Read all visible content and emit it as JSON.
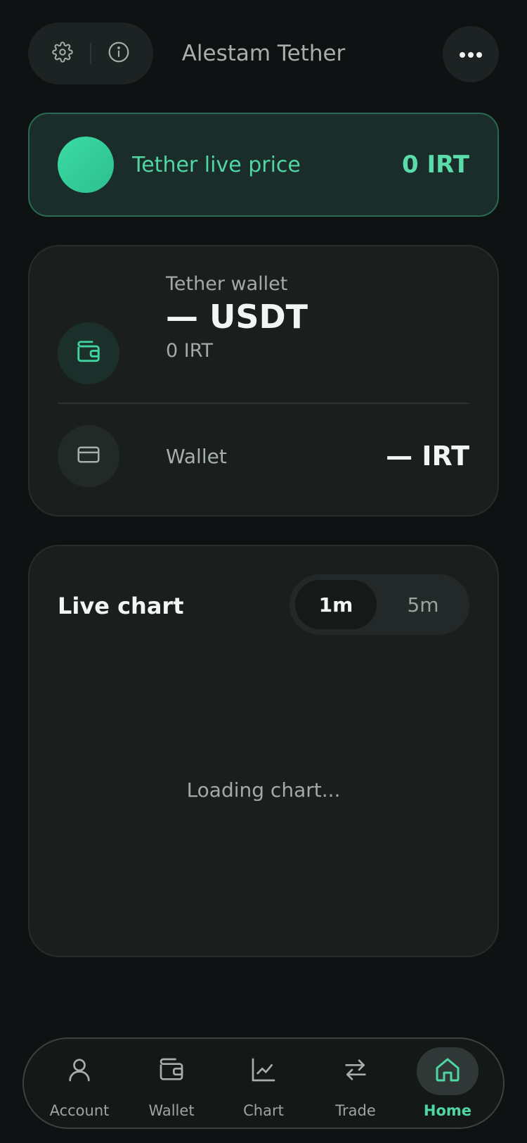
{
  "header": {
    "title": "Alestam Tether",
    "settings_icon": "gear-icon",
    "info_icon": "info-icon",
    "more_icon": "more-horizontal-icon"
  },
  "price_banner": {
    "label": "Tether live price",
    "value": "0 IRT",
    "accent_color": "#4fd6a3"
  },
  "wallet_card": {
    "tether": {
      "label": "Tether wallet",
      "amount": "— USDT",
      "irt_value": "0 IRT",
      "icon": "wallet-icon"
    },
    "wallet": {
      "label": "Wallet",
      "value": "— IRT",
      "icon": "credit-card-icon"
    }
  },
  "chart_card": {
    "title": "Live chart",
    "timeframes": [
      {
        "label": "1m",
        "active": true
      },
      {
        "label": "5m",
        "active": false
      }
    ],
    "loading_text": "Loading chart..."
  },
  "bottom_nav": {
    "items": [
      {
        "label": "Account",
        "icon": "user-icon",
        "active": false
      },
      {
        "label": "Wallet",
        "icon": "wallet-icon",
        "active": false
      },
      {
        "label": "Chart",
        "icon": "line-chart-icon",
        "active": false
      },
      {
        "label": "Trade",
        "icon": "swap-arrows-icon",
        "active": false
      },
      {
        "label": "Home",
        "icon": "home-icon",
        "active": true
      }
    ]
  }
}
